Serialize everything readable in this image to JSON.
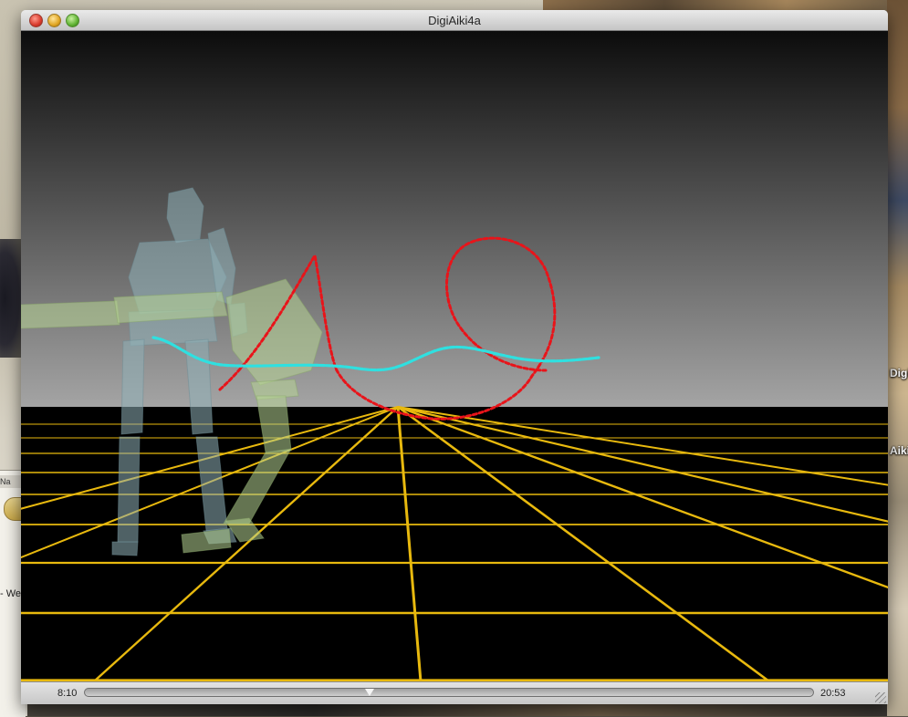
{
  "window": {
    "title": "DigiAiki4a"
  },
  "playback": {
    "current_time": "8:10",
    "total_time": "20:53",
    "progress": 0.391
  },
  "desktop": {
    "left_tab_label": "Na",
    "left_text": "- We",
    "right_labels": [
      "Digi",
      "Aiki"
    ]
  },
  "scene": {
    "sky_top_color": "#0c0c0c",
    "sky_bottom_color": "#a4a4a4",
    "floor_color": "#000000",
    "grid_color": "#e8b90e",
    "trail_red_color": "#e8141a",
    "trail_cyan_color": "#2fe0e0",
    "figure_blue_color": "#8fb0b8",
    "figure_green_color": "#b6d494"
  },
  "icons": {
    "close": "close-icon",
    "minimize": "minimize-icon",
    "zoom": "zoom-icon",
    "playhead": "playhead-icon",
    "resize": "resize-grip-icon"
  }
}
